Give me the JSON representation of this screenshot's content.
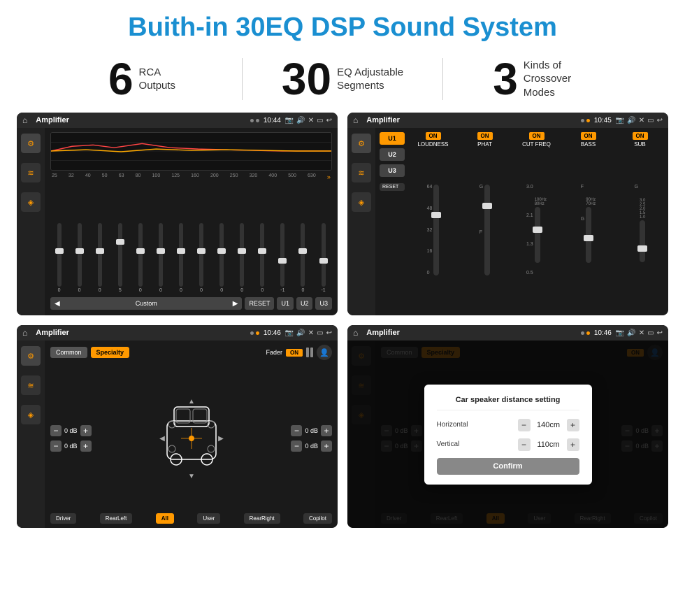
{
  "page": {
    "title": "Buith-in 30EQ DSP Sound System"
  },
  "stats": [
    {
      "number": "6",
      "label_line1": "RCA",
      "label_line2": "Outputs"
    },
    {
      "number": "30",
      "label_line1": "EQ Adjustable",
      "label_line2": "Segments"
    },
    {
      "number": "3",
      "label_line1": "Kinds of",
      "label_line2": "Crossover Modes"
    }
  ],
  "screens": [
    {
      "id": "eq-screen",
      "title": "Amplifier",
      "time": "10:44",
      "type": "equalizer",
      "freq_labels": [
        "25",
        "32",
        "40",
        "50",
        "63",
        "80",
        "100",
        "125",
        "160",
        "200",
        "250",
        "320",
        "400",
        "500",
        "630"
      ],
      "preset_name": "Custom",
      "presets": [
        "U1",
        "U2",
        "U3"
      ],
      "reset_label": "RESET",
      "slider_values": [
        "0",
        "0",
        "0",
        "5",
        "0",
        "0",
        "0",
        "0",
        "0",
        "0",
        "0",
        "-1",
        "0",
        "-1"
      ]
    },
    {
      "id": "crossover-screen",
      "title": "Amplifier",
      "time": "10:45",
      "type": "crossover",
      "presets": [
        "U1",
        "U2",
        "U3"
      ],
      "channels": [
        {
          "label": "LOUDNESS",
          "on": true
        },
        {
          "label": "PHAT",
          "on": true
        },
        {
          "label": "CUT FREQ",
          "on": true
        },
        {
          "label": "BASS",
          "on": true
        },
        {
          "label": "SUB",
          "on": true
        }
      ],
      "reset_label": "RESET"
    },
    {
      "id": "fader-screen",
      "title": "Amplifier",
      "time": "10:46",
      "type": "fader",
      "tabs": [
        "Common",
        "Specialty"
      ],
      "active_tab": "Specialty",
      "fader_label": "Fader",
      "fader_on": "ON",
      "db_values": [
        "0 dB",
        "0 dB",
        "0 dB",
        "0 dB"
      ],
      "bottom_btns": [
        "Driver",
        "RearLeft",
        "All",
        "User",
        "RearRight",
        "Copilot"
      ]
    },
    {
      "id": "dialog-screen",
      "title": "Amplifier",
      "time": "10:46",
      "type": "dialog",
      "tabs": [
        "Common",
        "Specialty"
      ],
      "active_tab": "Specialty",
      "dialog": {
        "title": "Car speaker distance setting",
        "rows": [
          {
            "label": "Horizontal",
            "value": "140cm"
          },
          {
            "label": "Vertical",
            "value": "110cm"
          }
        ],
        "confirm_label": "Confirm"
      },
      "db_values": [
        "0 dB",
        "0 dB"
      ],
      "bottom_btns": [
        "Driver",
        "RearLeft",
        "All",
        "User",
        "RearRight",
        "Copilot"
      ]
    }
  ]
}
